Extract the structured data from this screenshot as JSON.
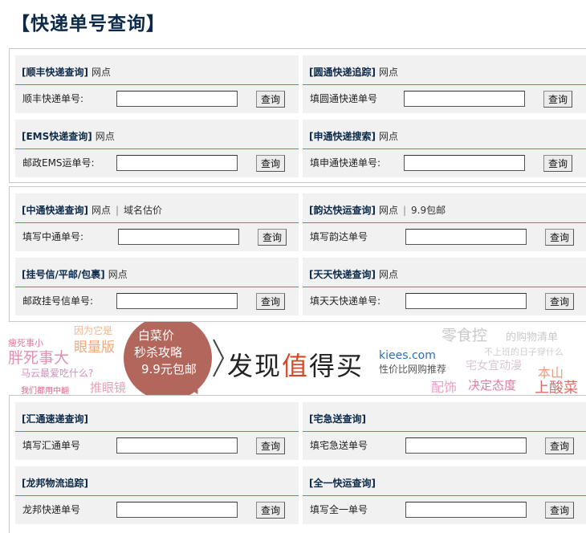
{
  "title": "【快递单号查询】",
  "button_label": "查询",
  "groups": [
    {
      "cards": [
        {
          "title": "[顺丰快递查询]",
          "extra": "网点",
          "extra2": "",
          "label": "顺丰快递单号:"
        },
        {
          "title": "[圆通快递追踪]",
          "extra": "网点",
          "extra2": "",
          "label": "填圆通快递单号"
        },
        {
          "title": "[EMS快递查询]",
          "extra": "网点",
          "extra2": "",
          "label": "邮政EMS运单号:"
        },
        {
          "title": "[申通快递搜索]",
          "extra": "网点",
          "extra2": "",
          "label": "填申通快递单号:"
        }
      ]
    },
    {
      "cards": [
        {
          "title": "[中通快递查询]",
          "extra": "网点",
          "extra2": "域名估价",
          "label": "填写中通单号:"
        },
        {
          "title": "[韵达快运查询]",
          "extra": "网点",
          "extra2": "9.9包邮",
          "label": "填写韵达单号"
        },
        {
          "title": "[挂号信/平邮/包裹]",
          "extra": "网点",
          "extra2": "",
          "label": "邮政挂号信单号:"
        },
        {
          "title": "[天天快递查询]",
          "extra": "网点",
          "extra2": "",
          "label": "填天天快递单号:"
        }
      ]
    },
    {
      "cards": [
        {
          "title": "[汇通速递查询]",
          "extra": "",
          "extra2": "",
          "label": "填写汇通单号"
        },
        {
          "title": "[宅急送查询]",
          "extra": "",
          "extra2": "",
          "label": "填宅急送单号"
        },
        {
          "title": "[龙邦物流追踪]",
          "extra": "",
          "extra2": "",
          "label": "龙邦快递单号"
        },
        {
          "title": "[全一快运查询]",
          "extra": "",
          "extra2": "",
          "label": "填写全一单号"
        }
      ]
    }
  ],
  "banner": {
    "bubble_lines": [
      "白菜价",
      "秒杀攻略",
      "9.9元包邮"
    ],
    "slogan_before": "发现",
    "slogan_highlight": "值",
    "slogan_after": "得买",
    "domain": "kiees.com",
    "tagline": "性价比网购推荐",
    "words": [
      "瘦死事小",
      "胖死事大",
      "因为它是",
      "眼量版",
      "马云最爱吃什么?",
      "我们都用中翻",
      "推眼镜",
      "零食控",
      "的购物清单",
      "不上班的日子穿什么",
      "宅女宜动漫",
      "本山",
      "配饰",
      "决定态度",
      "上酸菜"
    ]
  }
}
